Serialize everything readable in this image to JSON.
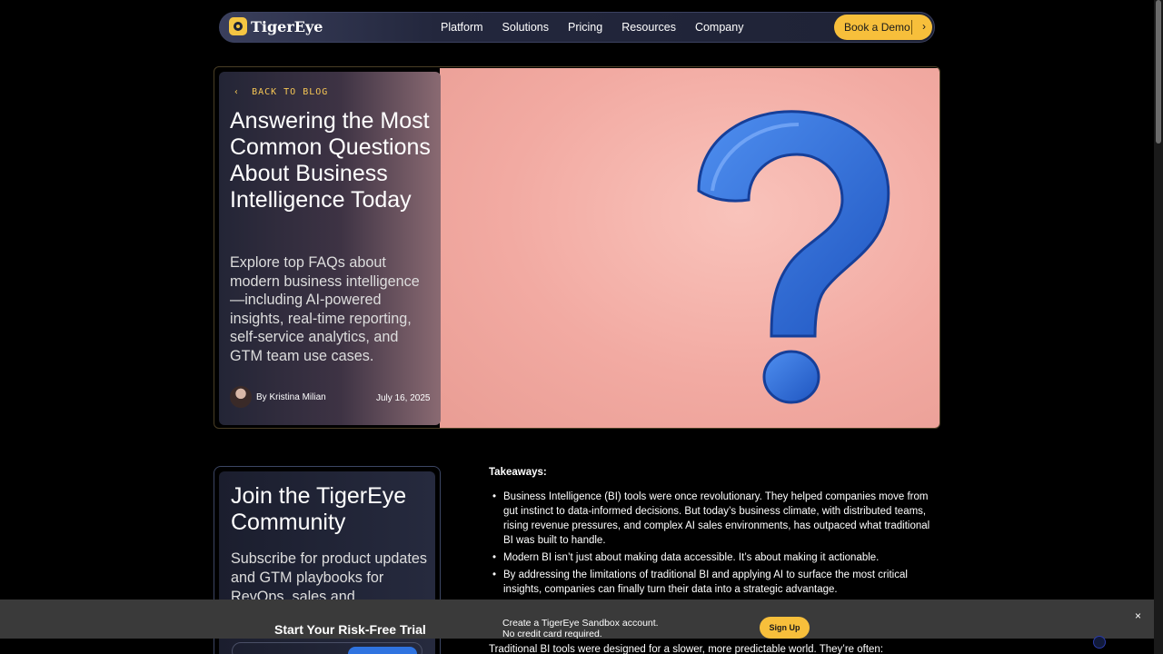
{
  "nav": {
    "logo_text": "TigerEye",
    "links": [
      "Platform",
      "Solutions",
      "Pricing",
      "Resources",
      "Company"
    ],
    "cta_label": "Book a Demo",
    "cta_arrow": "›"
  },
  "hero": {
    "back_label": "BACK TO BLOG",
    "back_icon": "‹",
    "title": "Answering the Most Common Questions About Business Intelligence Today",
    "subtitle": "Explore top FAQs about modern business intelligence —including AI-powered insights, real-time reporting, self-service analytics, and GTM team use cases.",
    "author": "By Kristina Milian",
    "date": "July 16, 2025",
    "image_subject": "question-mark"
  },
  "join": {
    "title": "Join the TigerEye Community",
    "subtitle": "Subscribe for product updates and GTM playbooks for RevOps, sales and"
  },
  "article": {
    "takeaways_label": "Takeaways:",
    "bullets": [
      "Business Intelligence (BI) tools were once revolutionary. They helped companies move from gut instinct to data-informed decisions. But today’s business climate, with distributed teams, rising revenue pressures, and complex AI sales environments, has outpaced what traditional BI was built to handle.",
      "Modern BI isn’t just about making data accessible. It’s about making it actionable.",
      "By addressing the limitations of traditional BI and applying AI to surface the most critical insights, companies can finally turn their data into a strategic advantage."
    ],
    "trailing_text": "Traditional BI tools were designed for a slower, more predictable world. They’re often:"
  },
  "banner": {
    "title": "Start Your Risk-Free Trial",
    "line1": "Create a TigerEye Sandbox account.",
    "line2": "No credit card required.",
    "signup_label": "Sign Up",
    "close_label": "×"
  },
  "colors": {
    "accent": "#f7bf3b",
    "hero_bg": "#f2aaa2",
    "question_mark": "#2f6fd6"
  }
}
